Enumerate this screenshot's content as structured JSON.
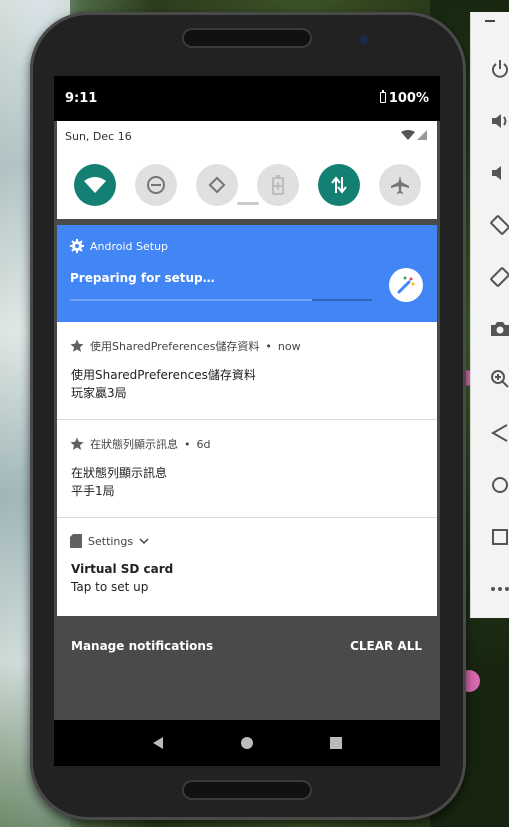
{
  "status_bar": {
    "time": "9:11",
    "battery": "100%"
  },
  "quick_settings": {
    "date": "Sun, Dec 16",
    "tiles": [
      {
        "icon": "wifi-icon",
        "active": true
      },
      {
        "icon": "do-not-disturb-icon",
        "active": false
      },
      {
        "icon": "auto-rotate-icon",
        "active": false
      },
      {
        "icon": "battery-saver-icon",
        "active": false
      },
      {
        "icon": "mobile-data-icon",
        "active": true
      },
      {
        "icon": "airplane-mode-icon",
        "active": false
      }
    ]
  },
  "notifications": {
    "setup": {
      "app": "Android Setup",
      "title": "Preparing for setup…"
    },
    "items": [
      {
        "app": "使用SharedPreferences儲存資料",
        "time": "now",
        "line1": "使用SharedPreferences儲存資料",
        "line2": "玩家贏3局"
      },
      {
        "app": "在狀態列顯示訊息",
        "time": "6d",
        "line1": "在狀態列顯示訊息",
        "line2": "平手1局"
      },
      {
        "app": "Settings",
        "line1": "Virtual SD card",
        "line2": "Tap to set up"
      }
    ],
    "footer": {
      "manage": "Manage notifications",
      "clear": "CLEAR ALL"
    }
  },
  "colors": {
    "accent": "#138073",
    "setup_blue": "#4285f4"
  },
  "emulator_toolbar": {
    "minimize": "–",
    "buttons": [
      "power-icon",
      "volume-up-icon",
      "volume-down-icon",
      "rotate-left-icon",
      "rotate-right-icon",
      "camera-icon",
      "zoom-icon",
      "back-icon",
      "home-icon",
      "overview-icon",
      "more-icon"
    ]
  }
}
